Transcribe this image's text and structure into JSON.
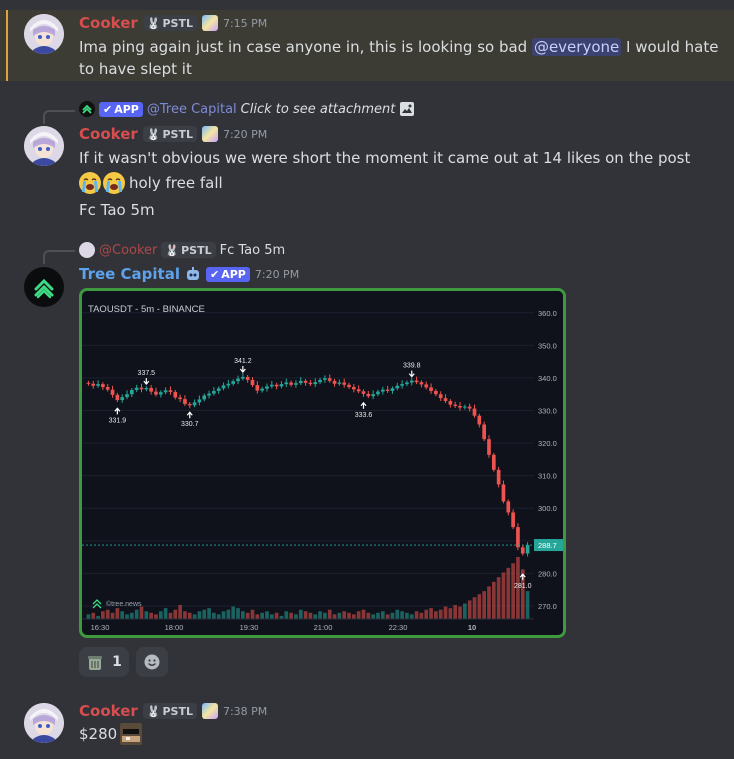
{
  "messages": [
    {
      "author": "Cooker",
      "badge": "PSTL",
      "time": "7:15 PM",
      "text_before": "Ima ping again just in case anyone in, this is looking so bad ",
      "mention": "@everyone",
      "text_after": " I would hate to have slept it"
    },
    {
      "reply": {
        "app_badge": "APP",
        "mention": "@Tree Capital",
        "italic": "Click to see attachment"
      },
      "author": "Cooker",
      "badge": "PSTL",
      "time": "7:20 PM",
      "lines": [
        "If it wasn't obvious we were short the moment it came out at 14 likes on the post",
        "holy free fall",
        "Fc Tao 5m"
      ]
    },
    {
      "reply": {
        "author": "@Cooker",
        "badge": "PSTL",
        "text": "Fc Tao 5m"
      },
      "author": "Tree Capital",
      "app_badge": "APP",
      "time": "7:20 PM",
      "reaction_count": "1"
    },
    {
      "author": "Cooker",
      "badge": "PSTL",
      "time": "7:38 PM",
      "text": "$280"
    }
  ],
  "colors": {
    "background": "#313338",
    "highlight": "#3c3b34",
    "author_red": "#d84e4e",
    "bot_blue": "#5ea2ec",
    "up": "#26a69a",
    "down": "#ef5350"
  },
  "chart_data": {
    "type": "candlestick",
    "title": "TAOUSDT - 5m - BINANCE",
    "watermark": "©tree.news",
    "x_tick_labels": [
      "16:30",
      "18:00",
      "19:30",
      "21:00",
      "22:30",
      "10"
    ],
    "y_tick_labels": [
      "360.0",
      "350.0",
      "340.0",
      "330.0",
      "320.0",
      "310.0",
      "300.0",
      "290.0",
      "280.0",
      "270.0"
    ],
    "ylim": [
      266,
      363
    ],
    "last_price": "288.7",
    "annotations": [
      {
        "label": "331.9",
        "value": 331.9,
        "kind": "low",
        "bar": 6
      },
      {
        "label": "337.5",
        "value": 337.5,
        "kind": "high",
        "bar": 12
      },
      {
        "label": "330.7",
        "value": 330.7,
        "kind": "low",
        "bar": 21
      },
      {
        "label": "341.2",
        "value": 341.2,
        "kind": "high",
        "bar": 32
      },
      {
        "label": "333.6",
        "value": 333.6,
        "kind": "low",
        "bar": 57
      },
      {
        "label": "339.8",
        "value": 339.8,
        "kind": "high",
        "bar": 67
      },
      {
        "label": "281.0",
        "value": 281.0,
        "kind": "low",
        "bar": 90
      }
    ],
    "close": [
      338.2,
      337.6,
      338.1,
      337.2,
      336.4,
      334.8,
      333.2,
      334.1,
      335.0,
      336.3,
      337.0,
      336.5,
      336.9,
      335.8,
      334.9,
      335.6,
      336.2,
      335.7,
      334.0,
      333.5,
      332.0,
      331.6,
      332.5,
      333.4,
      334.6,
      335.2,
      336.0,
      336.8,
      337.7,
      338.2,
      339.0,
      339.8,
      340.3,
      339.4,
      337.8,
      336.1,
      336.7,
      337.4,
      337.9,
      337.4,
      338.1,
      338.6,
      337.9,
      338.4,
      339.1,
      338.5,
      338.1,
      338.7,
      339.4,
      339.9,
      339.1,
      338.2,
      338.6,
      337.9,
      337.2,
      336.5,
      335.9,
      335.1,
      334.4,
      335.0,
      335.8,
      336.4,
      336.0,
      336.8,
      337.6,
      338.1,
      338.6,
      339.2,
      338.7,
      338.0,
      337.1,
      336.0,
      335.0,
      333.8,
      332.9,
      331.8,
      331.4,
      330.9,
      331.2,
      330.6,
      328.4,
      325.7,
      321.2,
      316.4,
      311.8,
      307.3,
      302.1,
      298.7,
      294.2,
      288.0,
      286.1,
      288.7
    ],
    "volume": [
      3,
      4,
      2,
      5,
      6,
      4,
      7,
      5,
      3,
      4,
      6,
      8,
      5,
      4,
      3,
      5,
      7,
      4,
      6,
      9,
      5,
      4,
      3,
      5,
      6,
      7,
      4,
      3,
      5,
      6,
      8,
      7,
      5,
      4,
      6,
      3,
      4,
      5,
      3,
      4,
      2,
      5,
      4,
      3,
      6,
      5,
      4,
      3,
      5,
      4,
      6,
      3,
      4,
      5,
      4,
      3,
      5,
      6,
      4,
      3,
      4,
      5,
      3,
      4,
      6,
      5,
      4,
      3,
      5,
      4,
      6,
      7,
      5,
      6,
      8,
      7,
      9,
      8,
      10,
      12,
      14,
      16,
      18,
      21,
      24,
      27,
      30,
      33,
      36,
      40,
      32,
      18
    ],
    "volume_unit": "relative"
  }
}
